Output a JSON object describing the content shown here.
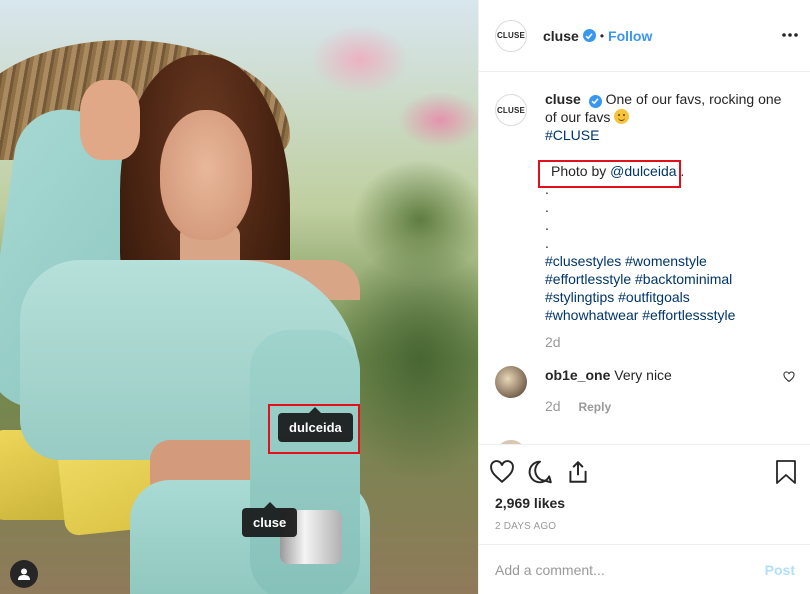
{
  "post": {
    "account": "cluse",
    "avatar_text": "CLUSE",
    "separator": "•",
    "follow_label": "Follow"
  },
  "photo": {
    "tags": [
      {
        "label": "dulceida"
      },
      {
        "label": "cluse"
      }
    ]
  },
  "caption": {
    "username": "cluse",
    "text": "One of our favs, rocking one of our favs",
    "hashtag": "#CLUSE",
    "credit_prefix": "Photo by",
    "credit_mention": "@dulceida",
    "credit_suffix": ".",
    "dots": [
      ".",
      ".",
      ".",
      "."
    ],
    "hashtag_lines": [
      "#clusestyles #womenstyle",
      "#effortlesstyle #backtominimal",
      "#stylingtips #outfitgoals",
      "#whowhatwear #effortlessstyle"
    ],
    "age": "2d"
  },
  "comments": [
    {
      "username": "ob1e_one",
      "text": "Very nice",
      "age": "2d",
      "reply_label": "Reply"
    }
  ],
  "stats": {
    "likes": "2,969 likes",
    "date": "2 DAYS AGO"
  },
  "composer": {
    "placeholder": "Add a comment...",
    "post_label": "Post"
  },
  "colors": {
    "link": "#003569",
    "accent": "#3897f0",
    "highlight_box": "#e0101c"
  }
}
